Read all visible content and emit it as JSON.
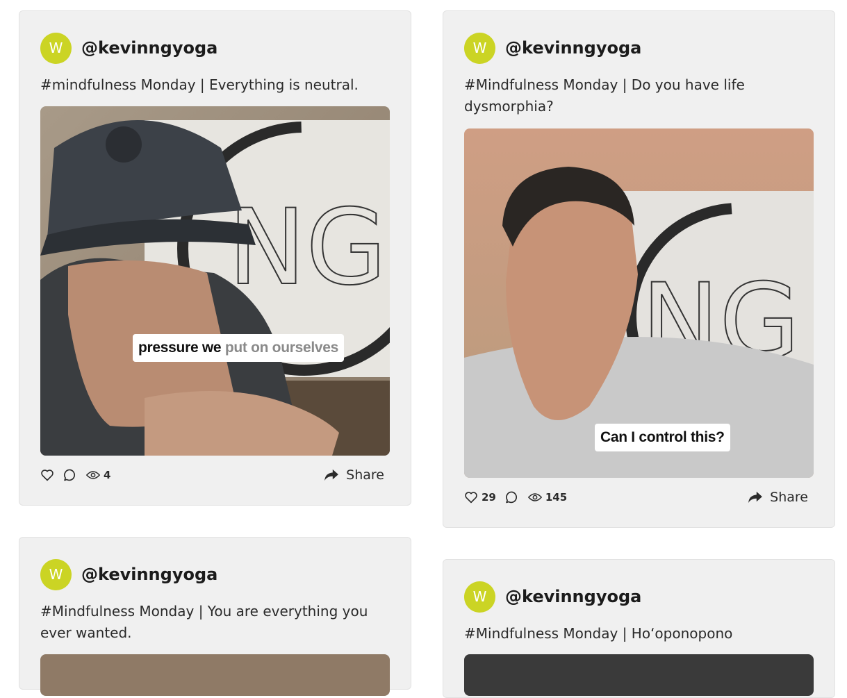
{
  "posts": [
    {
      "avatar_letter": "W",
      "handle": "@kevinngyoga",
      "caption": "#mindfulness Monday | Everything is neutral.",
      "overlay_strong": "pressure we",
      "overlay_dim": "put on ourselves",
      "likes": "",
      "views": "4",
      "share_label": "Share"
    },
    {
      "avatar_letter": "W",
      "handle": "@kevinngyoga",
      "caption": "#Mindfulness Monday | Do you have life dysmorphia?",
      "overlay_strong": "Can I control this?",
      "overlay_dim": "",
      "likes": "29",
      "views": "145",
      "share_label": "Share"
    },
    {
      "avatar_letter": "W",
      "handle": "@kevinngyoga",
      "caption": "#Mindfulness Monday | You are everything you ever wanted."
    },
    {
      "avatar_letter": "W",
      "handle": "@kevinngyoga",
      "caption": "#Mindfulness Monday | Ho‘oponopono"
    }
  ],
  "brand_color": "#cbd424",
  "card_background": "#f0f0f0",
  "icons": [
    "heart-icon",
    "comment-icon",
    "eye-icon",
    "share-arrow-icon"
  ]
}
